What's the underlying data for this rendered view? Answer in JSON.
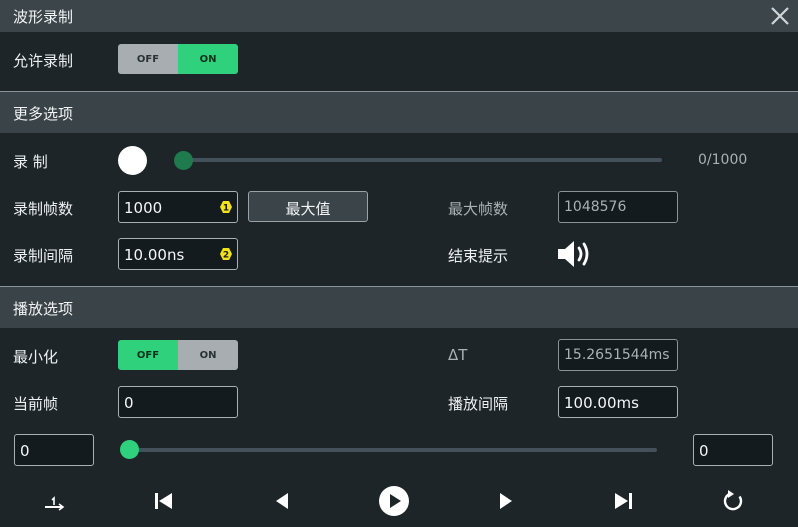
{
  "title": "波形录制",
  "enable": {
    "label": "允许录制",
    "off": "OFF",
    "on": "ON",
    "state": "on"
  },
  "more": {
    "header": "更多选项",
    "record_label": "录 制",
    "record_progress": "0/1000",
    "frames_label": "录制帧数",
    "frames_value": "1000",
    "max_button": "最大值",
    "max_frames_label": "最大帧数",
    "max_frames_value": "1048576",
    "interval_label": "录制间隔",
    "interval_value": "10.00ns",
    "end_hint_label": "结束提示",
    "badge1": "1",
    "badge2": "2"
  },
  "play": {
    "header": "播放选项",
    "minimize_label": "最小化",
    "minimize_off": "OFF",
    "minimize_on": "ON",
    "minimize_state": "off",
    "delta_label": "ΔT",
    "delta_value": "15.2651544ms",
    "current_label": "当前帧",
    "current_value": "0",
    "interval_label": "播放间隔",
    "interval_value": "100.00ms",
    "range_start": "0",
    "range_end": "0"
  },
  "colors": {
    "accent": "#2fd17d",
    "record_knob": "#1f7a4e",
    "badge": "#f1e21b"
  },
  "icons": [
    "close-icon",
    "speaker-icon",
    "step-icon",
    "skip-first-icon",
    "prev-icon",
    "play-icon",
    "next-icon",
    "skip-last-icon",
    "repeat-icon"
  ]
}
